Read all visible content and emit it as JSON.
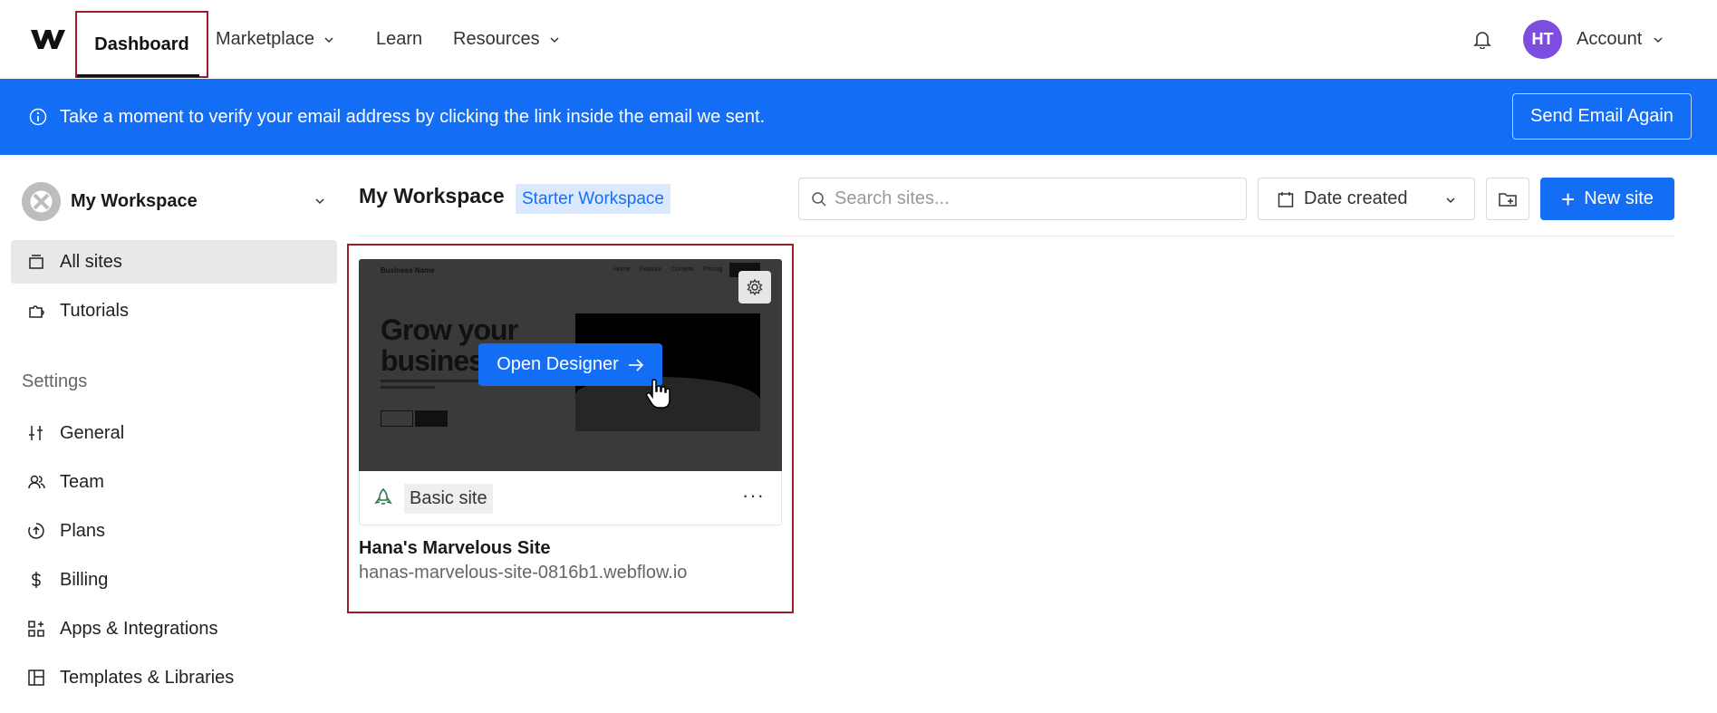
{
  "topnav": {
    "items": [
      {
        "label": "Dashboard"
      },
      {
        "label": "Marketplace"
      },
      {
        "label": "Learn"
      },
      {
        "label": "Resources"
      }
    ],
    "account": {
      "initials": "HT",
      "label": "Account",
      "avatar_color": "#7c4dde"
    }
  },
  "banner": {
    "message": "Take a moment to verify your email address by clicking the link inside the email we sent.",
    "button_label": "Send Email Again",
    "color": "#146ef5"
  },
  "sidebar": {
    "workspace_name": "My Workspace",
    "nav": [
      {
        "label": "All sites",
        "icon": "sites-icon"
      },
      {
        "label": "Tutorials",
        "icon": "puzzle-icon"
      }
    ],
    "settings_heading": "Settings",
    "settings": [
      {
        "label": "General",
        "icon": "sliders-icon"
      },
      {
        "label": "Team",
        "icon": "team-icon"
      },
      {
        "label": "Plans",
        "icon": "plans-icon"
      },
      {
        "label": "Billing",
        "icon": "dollar-icon"
      },
      {
        "label": "Apps & Integrations",
        "icon": "apps-icon"
      },
      {
        "label": "Templates & Libraries",
        "icon": "templates-icon"
      }
    ]
  },
  "main": {
    "title": "My Workspace",
    "plan_badge": "Starter Workspace",
    "search_placeholder": "Search sites...",
    "sort_label": "Date created",
    "new_site_label": "New site"
  },
  "site_card": {
    "thumbnail": {
      "brand": "Business Name",
      "nav": [
        "Home",
        "Feature",
        "Content",
        "Pricing"
      ],
      "hero_line1": "Grow your",
      "hero_line2": "business"
    },
    "open_designer_label": "Open Designer",
    "plan_label": "Basic site",
    "name": "Hana's Marvelous Site",
    "url": "hanas-marvelous-site-0816b1.webflow.io"
  }
}
